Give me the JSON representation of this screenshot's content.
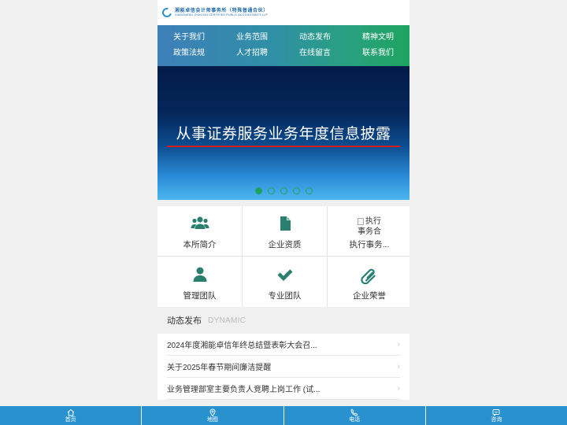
{
  "header": {
    "logo_cn": "湘能卓信会计师事务所（特殊普通合伙）",
    "logo_en": "XIANGNENG ZHUOXIN CERTIFIED PUBLIC ACCOUNTANTS LLP"
  },
  "nav": {
    "items": [
      "关于我们",
      "业务范围",
      "动态发布",
      "精神文明",
      "政策法规",
      "人才招聘",
      "在线留言",
      "联系我们"
    ]
  },
  "banner": {
    "title": "从事证券服务业务年度信息披露",
    "slide_count": 5,
    "active_slide": 1
  },
  "grid": {
    "items": [
      {
        "label": "本所简介",
        "icon": "users-icon"
      },
      {
        "label": "企业资质",
        "icon": "document-icon"
      },
      {
        "label": "执行事务...",
        "icon": "broken-image",
        "alt_line1": "执行",
        "alt_line2": "事务合"
      },
      {
        "label": "管理团队",
        "icon": "user-icon"
      },
      {
        "label": "专业团队",
        "icon": "check-icon"
      },
      {
        "label": "企业荣誉",
        "icon": "paperclip-icon"
      }
    ]
  },
  "news": {
    "title": "动态发布",
    "subtitle": "DYNAMIC",
    "items": [
      "2024年度湘能卓信年终总结暨表彰大会召...",
      "关于2025年春节期间廉洁提醒",
      "业务管理部室主要负责人竞聘上岗工作 (试..."
    ]
  },
  "bottom_bar": {
    "tabs": [
      {
        "label": "首页",
        "icon": "home-icon"
      },
      {
        "label": "地图",
        "icon": "map-pin-icon"
      },
      {
        "label": "电话",
        "icon": "phone-icon"
      },
      {
        "label": "咨询",
        "icon": "chat-icon"
      }
    ]
  },
  "colors": {
    "accent_green": "#1ea35f",
    "icon_teal": "#2a7f6f",
    "bottom_bar": "#2a91cf",
    "banner_rule": "#d3201c"
  }
}
